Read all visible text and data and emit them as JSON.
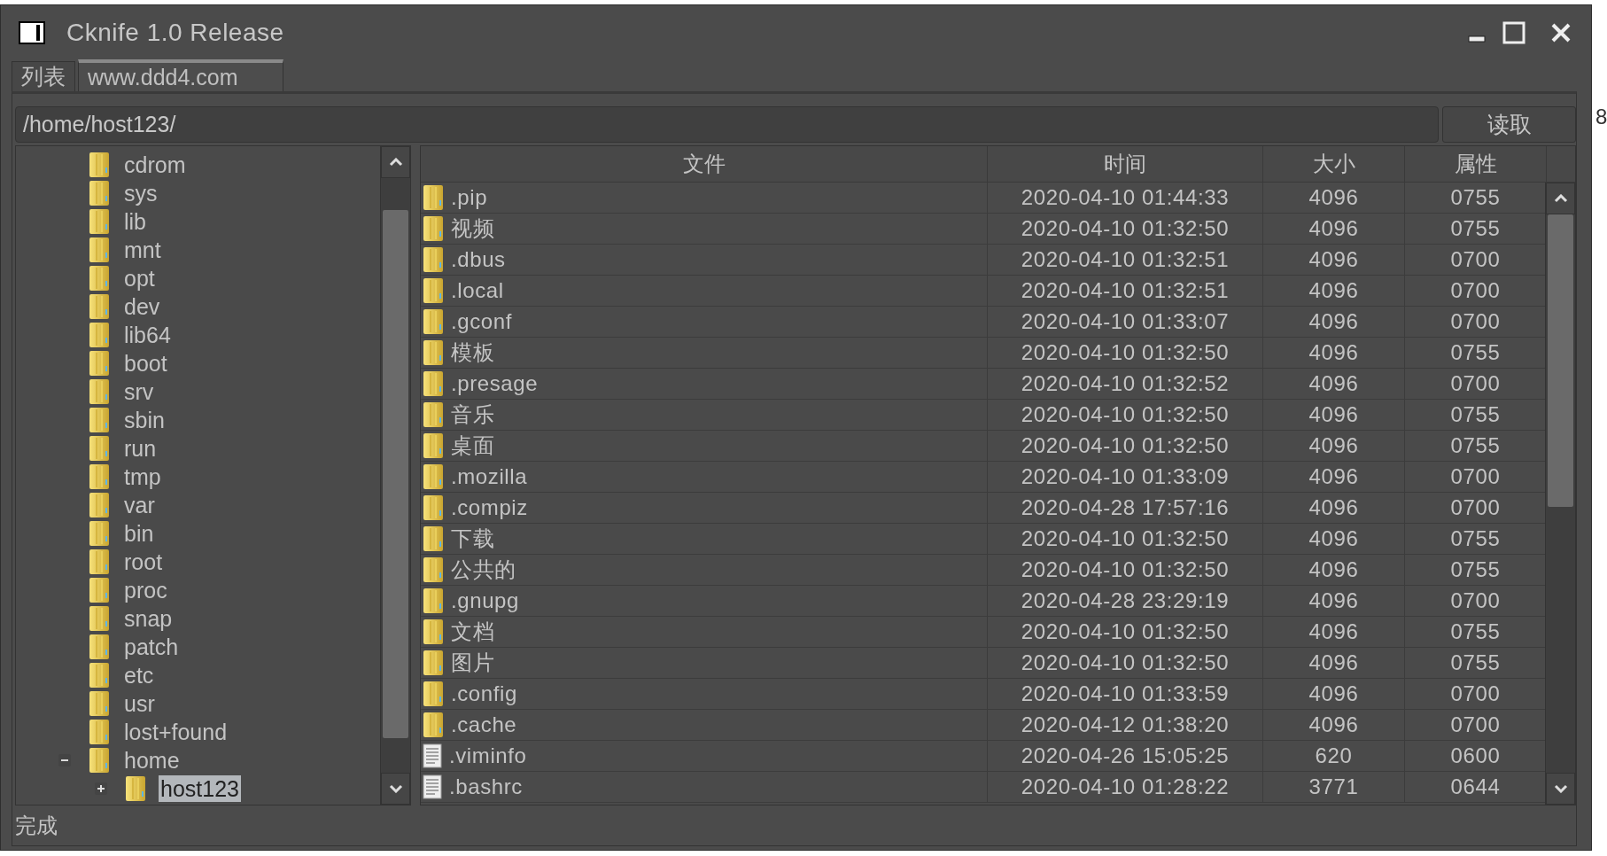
{
  "window": {
    "title": "Cknife 1.0 Release"
  },
  "tabs": [
    {
      "label": "列表",
      "selected": false
    },
    {
      "label": "www.ddd4.com",
      "selected": true
    }
  ],
  "path": {
    "value": "/home/host123/"
  },
  "read_button": "读取",
  "tree": {
    "items": [
      {
        "label": "cdrom",
        "selected": false
      },
      {
        "label": "sys",
        "selected": false
      },
      {
        "label": "lib",
        "selected": false
      },
      {
        "label": "mnt",
        "selected": false
      },
      {
        "label": "opt",
        "selected": false
      },
      {
        "label": "dev",
        "selected": false
      },
      {
        "label": "lib64",
        "selected": false
      },
      {
        "label": "boot",
        "selected": false
      },
      {
        "label": "srv",
        "selected": false
      },
      {
        "label": "sbin",
        "selected": false
      },
      {
        "label": "run",
        "selected": false
      },
      {
        "label": "tmp",
        "selected": false
      },
      {
        "label": "var",
        "selected": false
      },
      {
        "label": "bin",
        "selected": false
      },
      {
        "label": "root",
        "selected": false
      },
      {
        "label": "proc",
        "selected": false
      },
      {
        "label": "snap",
        "selected": false
      },
      {
        "label": "patch",
        "selected": false
      },
      {
        "label": "etc",
        "selected": false
      },
      {
        "label": "usr",
        "selected": false
      },
      {
        "label": "lost+found",
        "selected": false
      },
      {
        "label": "home",
        "selected": false,
        "expanded": true,
        "children": [
          {
            "label": "host123",
            "selected": true,
            "expanded": false
          }
        ]
      }
    ]
  },
  "table": {
    "columns": [
      "文件",
      "时间",
      "大小",
      "属性"
    ],
    "rows": [
      {
        "kind": "folder",
        "cells": [
          ".pip",
          "2020-04-10 01:44:33",
          "4096",
          "0755"
        ]
      },
      {
        "kind": "folder",
        "cells": [
          "视频",
          "2020-04-10 01:32:50",
          "4096",
          "0755"
        ]
      },
      {
        "kind": "folder",
        "cells": [
          ".dbus",
          "2020-04-10 01:32:51",
          "4096",
          "0700"
        ]
      },
      {
        "kind": "folder",
        "cells": [
          ".local",
          "2020-04-10 01:32:51",
          "4096",
          "0700"
        ]
      },
      {
        "kind": "folder",
        "cells": [
          ".gconf",
          "2020-04-10 01:33:07",
          "4096",
          "0700"
        ]
      },
      {
        "kind": "folder",
        "cells": [
          "模板",
          "2020-04-10 01:32:50",
          "4096",
          "0755"
        ]
      },
      {
        "kind": "folder",
        "cells": [
          ".presage",
          "2020-04-10 01:32:52",
          "4096",
          "0700"
        ]
      },
      {
        "kind": "folder",
        "cells": [
          "音乐",
          "2020-04-10 01:32:50",
          "4096",
          "0755"
        ]
      },
      {
        "kind": "folder",
        "cells": [
          "桌面",
          "2020-04-10 01:32:50",
          "4096",
          "0755"
        ]
      },
      {
        "kind": "folder",
        "cells": [
          ".mozilla",
          "2020-04-10 01:33:09",
          "4096",
          "0700"
        ]
      },
      {
        "kind": "folder",
        "cells": [
          ".compiz",
          "2020-04-28 17:57:16",
          "4096",
          "0700"
        ]
      },
      {
        "kind": "folder",
        "cells": [
          "下载",
          "2020-04-10 01:32:50",
          "4096",
          "0755"
        ]
      },
      {
        "kind": "folder",
        "cells": [
          "公共的",
          "2020-04-10 01:32:50",
          "4096",
          "0755"
        ]
      },
      {
        "kind": "folder",
        "cells": [
          ".gnupg",
          "2020-04-28 23:29:19",
          "4096",
          "0700"
        ]
      },
      {
        "kind": "folder",
        "cells": [
          "文档",
          "2020-04-10 01:32:50",
          "4096",
          "0755"
        ]
      },
      {
        "kind": "folder",
        "cells": [
          "图片",
          "2020-04-10 01:32:50",
          "4096",
          "0755"
        ]
      },
      {
        "kind": "folder",
        "cells": [
          ".config",
          "2020-04-10 01:33:59",
          "4096",
          "0700"
        ]
      },
      {
        "kind": "folder",
        "cells": [
          ".cache",
          "2020-04-12 01:38:20",
          "4096",
          "0700"
        ]
      },
      {
        "kind": "file",
        "cells": [
          ".viminfo",
          "2020-04-26 15:05:25",
          "620",
          "0600"
        ]
      },
      {
        "kind": "file",
        "cells": [
          ".bashrc",
          "2020-04-10 01:28:22",
          "3771",
          "0644"
        ]
      }
    ]
  },
  "status_bar": "完成",
  "background_text": "8"
}
